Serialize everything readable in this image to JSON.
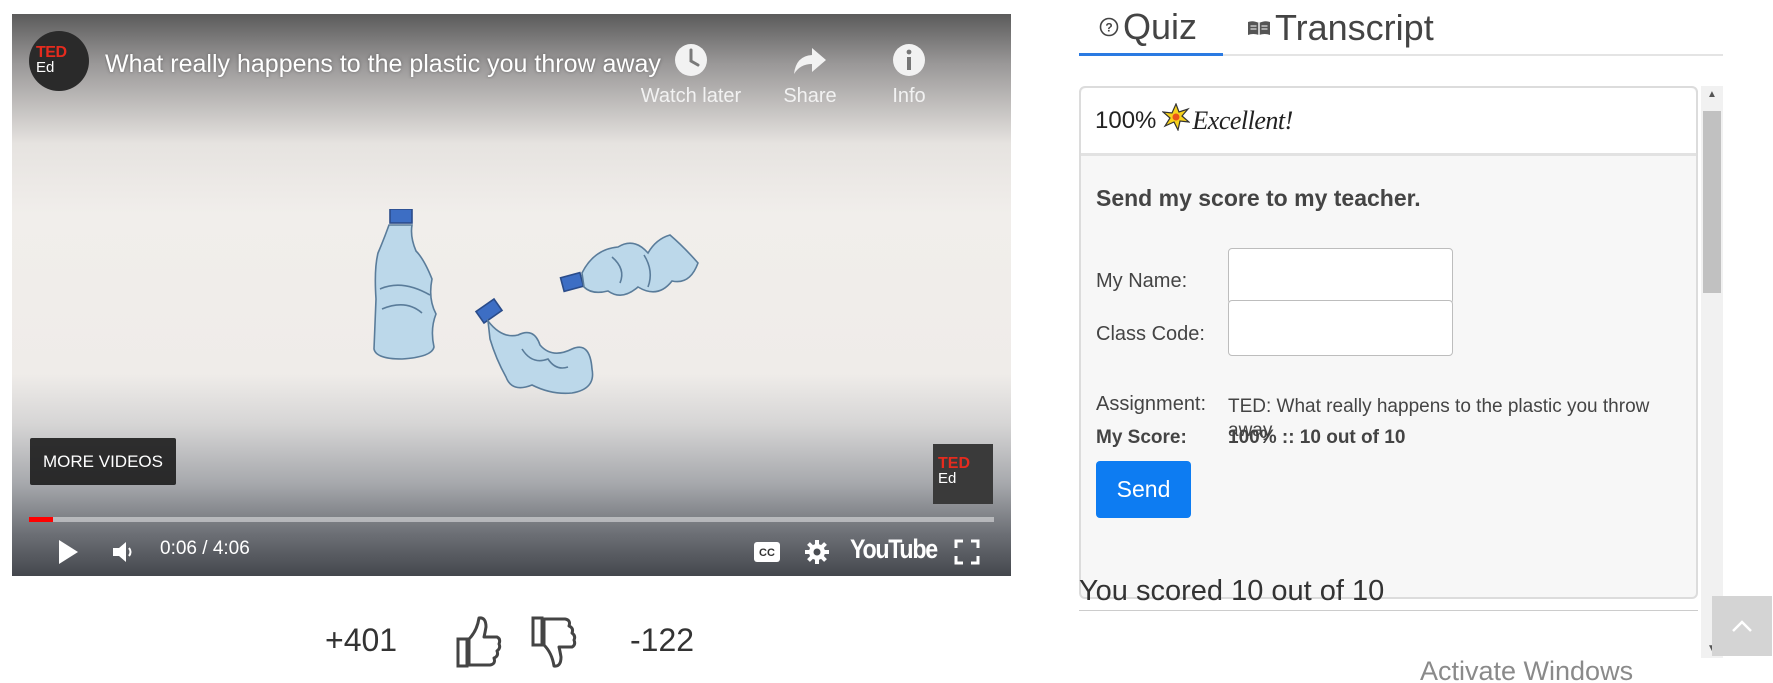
{
  "player": {
    "title": "What really happens to the plastic you throw away",
    "channel_logo_top": "TED",
    "channel_logo_bottom": "Ed",
    "actions": {
      "watch_later": "Watch later",
      "share": "Share",
      "info": "Info"
    },
    "more_videos": "MORE VIDEOS",
    "time_display": "0:06 / 4:06",
    "progress_fraction": 0.025,
    "brand": "YouTube",
    "accent_color": "#ff0000"
  },
  "votes": {
    "up": "+401",
    "down": "-122"
  },
  "tabs": [
    {
      "label": "Quiz",
      "icon": "question-circle-icon",
      "active": true
    },
    {
      "label": "Transcript",
      "icon": "book-icon",
      "active": false
    }
  ],
  "quiz": {
    "score_percent": "100%",
    "rating": "Excellent!",
    "send_title": "Send my score to my teacher.",
    "name_label": "My Name:",
    "name_value": "",
    "class_label": "Class Code:",
    "class_value": "",
    "assignment_label": "Assignment:",
    "assignment_value": "TED: What really happens to the plastic you throw away",
    "my_score_label": "My Score:",
    "my_score_value": "100% :: 10 out of 10",
    "send_label": "Send",
    "send_color": "#0d7cf2",
    "scored_text": "You scored 10 out of 10"
  },
  "overlay": {
    "watermark": "Activate Windows"
  }
}
